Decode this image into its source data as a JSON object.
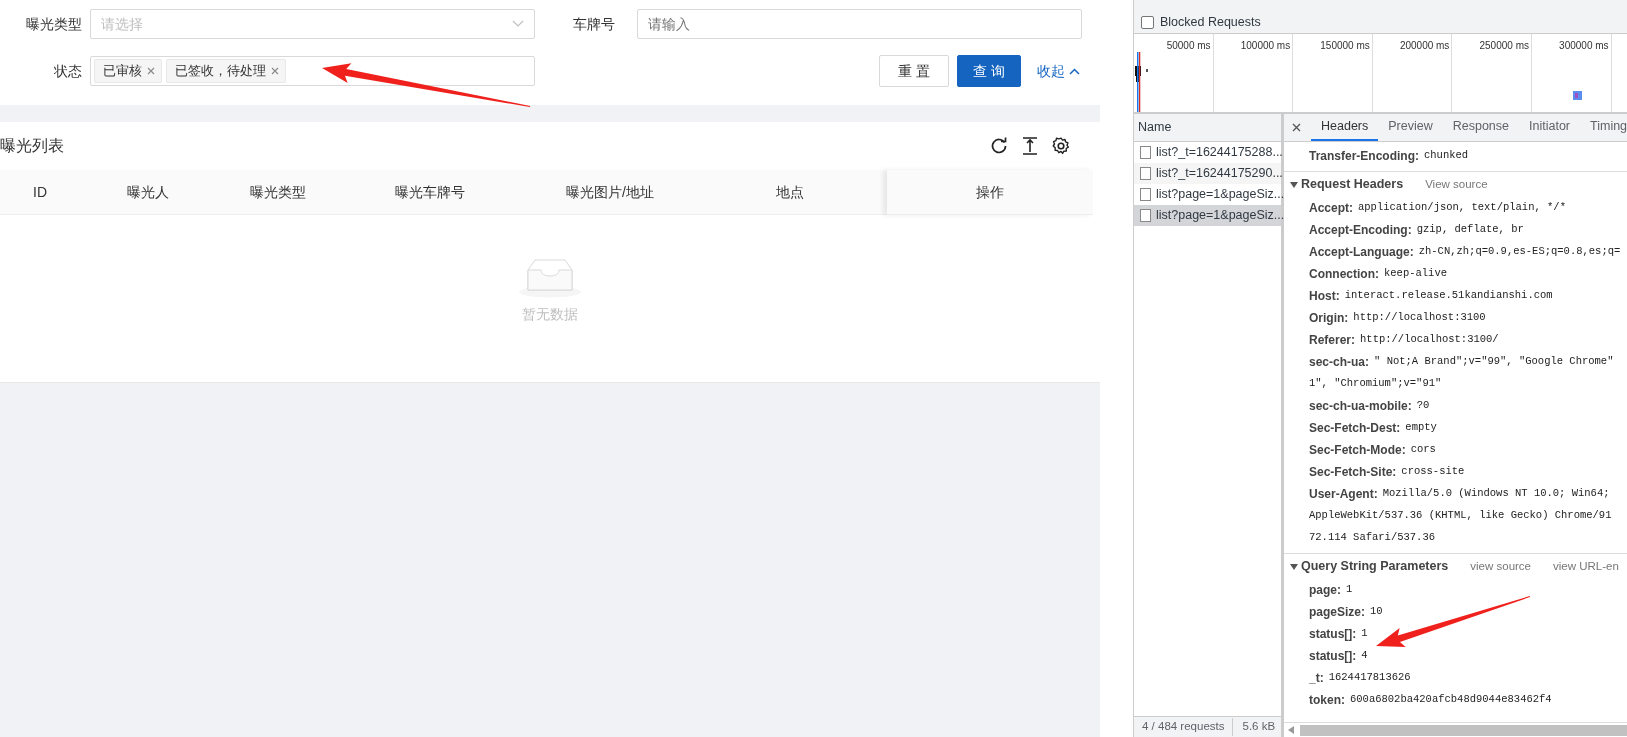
{
  "filters": [
    {
      "kind": "select",
      "label": "曝光类型",
      "placeholder": "请选择"
    },
    {
      "kind": "input",
      "label": "车牌号",
      "placeholder": "请输入"
    },
    {
      "kind": "tags",
      "label": "状态",
      "tags": [
        "已审核",
        "已签收，待处理"
      ]
    }
  ],
  "actions": {
    "reset": "重 置",
    "search": "查 询",
    "collapse": "收起"
  },
  "list": {
    "title": "曝光列表",
    "columns": [
      "ID",
      "曝光人",
      "曝光类型",
      "曝光车牌号",
      "曝光图片/地址",
      "地点",
      "操作"
    ],
    "empty_text": "暂无数据"
  },
  "devtools": {
    "blocked_requests": {
      "label": "Blocked Requests",
      "checked": false
    },
    "timeline_ticks": [
      "50000 ms",
      "100000 ms",
      "150000 ms",
      "200000 ms",
      "250000 ms",
      "300000 ms"
    ],
    "name_header": "Name",
    "requests": [
      {
        "name": "list?_t=16244175288...",
        "selected": false
      },
      {
        "name": "list?_t=16244175290...",
        "selected": false
      },
      {
        "name": "list?page=1&pageSiz...",
        "selected": false
      },
      {
        "name": "list?page=1&pageSiz...",
        "selected": true
      }
    ],
    "tabs": [
      {
        "label": "Headers",
        "selected": true
      },
      {
        "label": "Preview",
        "selected": false
      },
      {
        "label": "Response",
        "selected": false
      },
      {
        "label": "Initiator",
        "selected": false
      },
      {
        "label": "Timing",
        "selected": false
      }
    ],
    "response_tail": [
      {
        "key": "Transfer-Encoding:",
        "lines": [
          "chunked"
        ]
      }
    ],
    "sections": [
      {
        "title": "Request Headers",
        "expanded": true,
        "links": [
          "View source"
        ],
        "rows": [
          {
            "key": "Accept:",
            "lines": [
              "application/json, text/plain, */*"
            ]
          },
          {
            "key": "Accept-Encoding:",
            "lines": [
              "gzip, deflate, br"
            ]
          },
          {
            "key": "Accept-Language:",
            "lines": [
              "zh-CN,zh;q=0.9,es-ES;q=0.8,es;q="
            ]
          },
          {
            "key": "Connection:",
            "lines": [
              "keep-alive"
            ]
          },
          {
            "key": "Host:",
            "lines": [
              "interact.release.51kandianshi.com"
            ]
          },
          {
            "key": "Origin:",
            "lines": [
              "http://localhost:3100"
            ]
          },
          {
            "key": "Referer:",
            "lines": [
              "http://localhost:3100/"
            ]
          },
          {
            "key": "sec-ch-ua:",
            "lines": [
              "\" Not;A Brand\";v=\"99\", \"Google Chrome\"",
              "1\", \"Chromium\";v=\"91\""
            ]
          },
          {
            "key": "sec-ch-ua-mobile:",
            "lines": [
              "?0"
            ]
          },
          {
            "key": "Sec-Fetch-Dest:",
            "lines": [
              "empty"
            ]
          },
          {
            "key": "Sec-Fetch-Mode:",
            "lines": [
              "cors"
            ]
          },
          {
            "key": "Sec-Fetch-Site:",
            "lines": [
              "cross-site"
            ]
          },
          {
            "key": "User-Agent:",
            "lines": [
              "Mozilla/5.0 (Windows NT 10.0; Win64;",
              "AppleWebKit/537.36 (KHTML, like Gecko) Chrome/91",
              "72.114 Safari/537.36"
            ]
          }
        ]
      },
      {
        "title": "Query String Parameters",
        "expanded": true,
        "links": [
          "view source",
          "view URL-en"
        ],
        "rows": [
          {
            "key": "page:",
            "lines": [
              "1"
            ]
          },
          {
            "key": "pageSize:",
            "lines": [
              "10"
            ]
          },
          {
            "key": "status[]:",
            "lines": [
              "1"
            ]
          },
          {
            "key": "status[]:",
            "lines": [
              "4"
            ]
          },
          {
            "key": "_t:",
            "lines": [
              "1624417813626"
            ]
          },
          {
            "key": "token:",
            "lines": [
              "600a6802ba420afcb48d9044e83462f4"
            ]
          }
        ]
      }
    ],
    "footer": {
      "requests": "4 / 484 requests",
      "size": "5.6 kB"
    }
  }
}
